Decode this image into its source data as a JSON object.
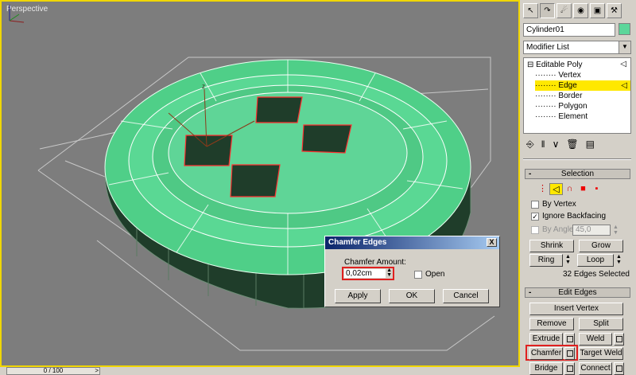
{
  "viewport": {
    "label": "Perspective"
  },
  "timeline": {
    "frame": "0 / 100",
    "arrow": ">"
  },
  "panel": {
    "tabs": [
      "arrow-pointer-icon",
      "bend-curve-icon",
      "hierarchy-icon",
      "motion-wheel-icon",
      "display-monitor-icon",
      "hammer-utilities-icon"
    ],
    "object_name": "Cylinder01",
    "object_color": "#5cd69a",
    "modifier_list": "Modifier List",
    "stack": {
      "root": "Editable Poly",
      "items": [
        "Vertex",
        "Edge",
        "Border",
        "Polygon",
        "Element"
      ],
      "selected": "Edge"
    },
    "selection": {
      "title": "Selection",
      "by_vertex": "By Vertex",
      "ignore_backfacing": "Ignore Backfacing",
      "by_angle": "By Angle:",
      "angle_value": "45,0",
      "shrink": "Shrink",
      "grow": "Grow",
      "ring": "Ring",
      "loop": "Loop",
      "status": "32 Edges Selected"
    },
    "edit_edges": {
      "title": "Edit Edges",
      "insert_vertex": "Insert Vertex",
      "remove": "Remove",
      "split": "Split",
      "extrude": "Extrude",
      "weld": "Weld",
      "chamfer": "Chamfer",
      "target_weld": "Target Weld",
      "bridge": "Bridge",
      "connect": "Connect"
    }
  },
  "dialog": {
    "title": "Chamfer Edges",
    "close": "X",
    "amount_label": "Chamfer Amount:",
    "amount_value": "0,02cm",
    "open_label": "Open",
    "apply": "Apply",
    "ok": "OK",
    "cancel": "Cancel"
  },
  "colors": {
    "accent_yellow": "#ffe800",
    "mesh_green": "#5cd69a",
    "highlight_red": "#e02020"
  }
}
